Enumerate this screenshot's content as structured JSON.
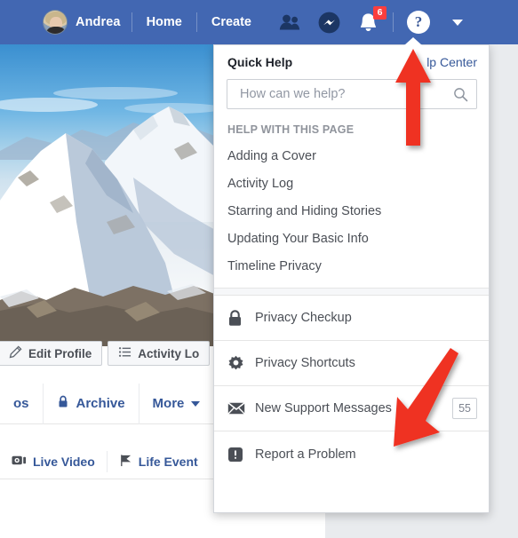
{
  "topbar": {
    "profile_name": "Andrea",
    "links": [
      {
        "label": "Home"
      },
      {
        "label": "Create"
      }
    ],
    "icons": [
      {
        "name": "friend-requests-icon",
        "glyph": "friends"
      },
      {
        "name": "messenger-icon",
        "glyph": "messenger"
      },
      {
        "name": "notifications-icon",
        "glyph": "bell",
        "badge": "6"
      },
      {
        "name": "help-icon",
        "glyph": "question"
      },
      {
        "name": "account-menu-icon",
        "glyph": "caret-down"
      }
    ],
    "notification_count": "6",
    "bg_color": "#4267b2"
  },
  "profile": {
    "actions": [
      {
        "label": "Edit Profile",
        "icon": "pencil-icon"
      },
      {
        "label": "Activity Lo",
        "icon": "list-icon"
      }
    ],
    "tabs": [
      {
        "label": "os",
        "icon": ""
      },
      {
        "label": "Archive",
        "icon": "lock-icon"
      },
      {
        "label": "More",
        "icon": "caret-down-icon"
      }
    ],
    "composer": [
      {
        "label": "Live Video",
        "icon": "video-camera-icon"
      },
      {
        "label": "Life Event",
        "icon": "flag-icon"
      }
    ]
  },
  "quick_help": {
    "title": "Quick Help",
    "help_center_link": "lp Center",
    "search": {
      "placeholder": "How can we help?",
      "value": "",
      "icon": "search-icon"
    },
    "section_label": "HELP WITH THIS PAGE",
    "help_items": [
      {
        "label": "Adding a Cover"
      },
      {
        "label": "Activity Log"
      },
      {
        "label": "Starring and Hiding Stories"
      },
      {
        "label": "Updating Your Basic Info"
      },
      {
        "label": "Timeline Privacy"
      }
    ],
    "menu_items": [
      {
        "label": "Privacy Checkup",
        "icon": "lock-icon",
        "badge": ""
      },
      {
        "label": "Privacy Shortcuts",
        "icon": "gear-icon",
        "badge": ""
      },
      {
        "label": "New Support Messages",
        "icon": "envelope-icon",
        "badge": "55"
      },
      {
        "label": "Report a Problem",
        "icon": "exclamation-icon",
        "badge": ""
      }
    ]
  },
  "annotations": {
    "arrow_color": "#ef3124",
    "arrows": [
      {
        "name": "arrow-to-help-button",
        "direction": "up"
      },
      {
        "name": "arrow-to-new-support-messages",
        "direction": "down-left"
      }
    ]
  }
}
